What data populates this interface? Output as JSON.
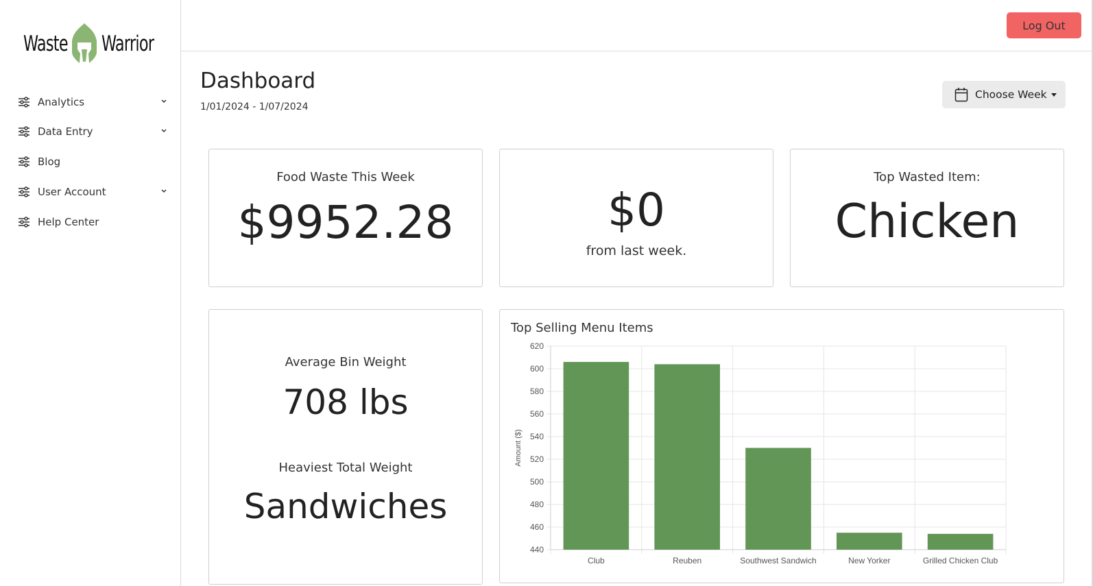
{
  "brand": {
    "left_word": "Waste",
    "right_word": "Warrior",
    "helmet_color": "#8bb573"
  },
  "sidebar": {
    "items": [
      {
        "label": "Analytics",
        "icon": "sliders-icon",
        "has_chevron": true
      },
      {
        "label": "Data Entry",
        "icon": "sliders-icon",
        "has_chevron": true
      },
      {
        "label": "Blog",
        "icon": "sliders-icon",
        "has_chevron": false
      },
      {
        "label": "User Account",
        "icon": "sliders-icon",
        "has_chevron": true
      },
      {
        "label": "Help Center",
        "icon": "sliders-icon",
        "has_chevron": false
      }
    ]
  },
  "header": {
    "logout_label": "Log Out",
    "logout_color": "#f26464"
  },
  "page": {
    "title": "Dashboard",
    "date_range": "1/01/2024 - 1/07/2024",
    "choose_week_label": "Choose Week"
  },
  "cards": {
    "food_waste": {
      "label": "Food Waste This Week",
      "value": "$9952.28"
    },
    "change": {
      "value": "$0",
      "label": "from last week."
    },
    "top_wasted": {
      "label": "Top Wasted Item:",
      "value": "Chicken"
    },
    "average_bin": {
      "label": "Average Bin Weight",
      "value": "708 lbs"
    },
    "heaviest": {
      "label": "Heaviest Total Weight",
      "value": "Sandwiches"
    }
  },
  "chart_data": {
    "type": "bar",
    "title": "Top Selling Menu Items",
    "ylabel": "Amount ($)",
    "xlabel": "",
    "categories": [
      "Club",
      "Reuben",
      "Southwest Sandwich",
      "New Yorker",
      "Grilled Chicken Club"
    ],
    "values": [
      606,
      604,
      530,
      455,
      454
    ],
    "ylim": [
      440,
      620
    ],
    "yticks": [
      440,
      460,
      480,
      500,
      520,
      540,
      560,
      580,
      600,
      620
    ],
    "bar_color": "#629656",
    "grid": true
  }
}
